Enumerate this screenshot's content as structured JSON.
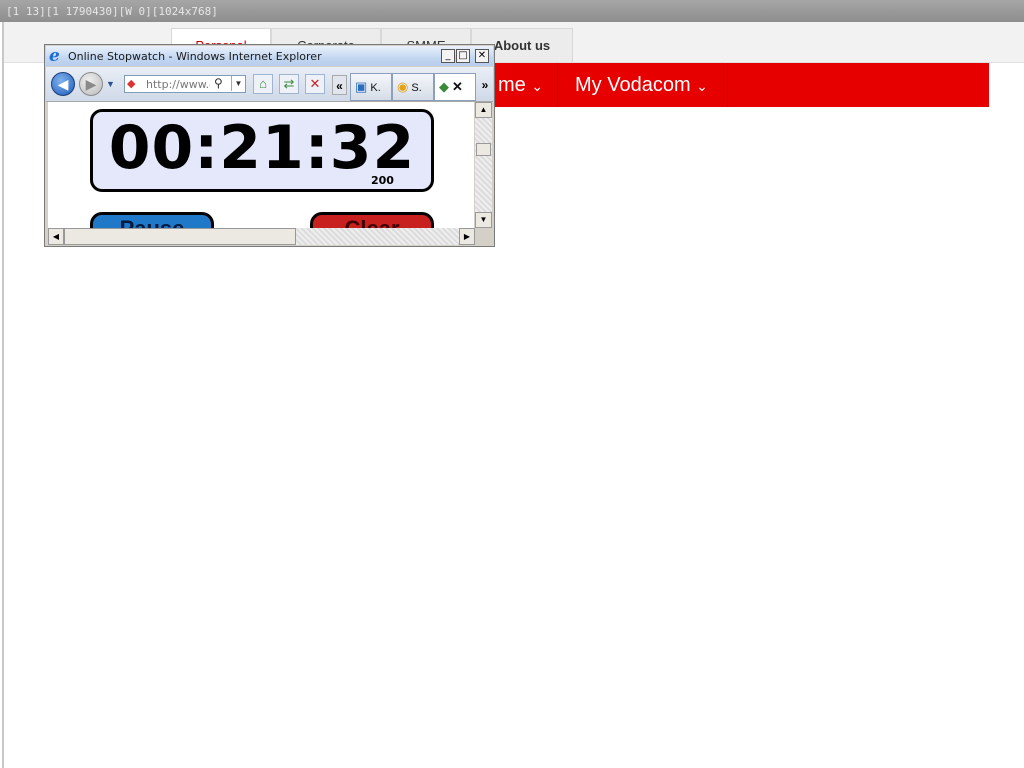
{
  "debug": {
    "text": "[1 13][1 1790430][W 0][1024x768]"
  },
  "vodacom": {
    "tabs": [
      "Personal",
      "Corporate",
      "SMME",
      "About us"
    ],
    "nav": {
      "home": "me",
      "my_vodacom": "My Vodacom",
      "chevron": "⌄"
    },
    "colors": {
      "brand_red": "#e60000"
    }
  },
  "ie": {
    "title": "Online Stopwatch - Windows Internet Explorer",
    "window_buttons": {
      "minimize": "_",
      "maximize": "□",
      "close": "✕"
    },
    "address": "http://www.o",
    "tabs": [
      {
        "label": "K."
      },
      {
        "label": "S."
      },
      {
        "label": "",
        "close": "✕"
      }
    ],
    "chevron_left": "«",
    "chevron_right": "»",
    "icons": [
      "ie-logo-icon",
      "back-arrow-icon",
      "forward-arrow-icon",
      "search-icon",
      "compat-view-icon",
      "refresh-icon",
      "stop-icon"
    ]
  },
  "stopwatch": {
    "time": "00:21:32",
    "milliseconds": "200",
    "pause_label": "Pause",
    "clear_label": "Clear",
    "colors": {
      "display_bg": "#e5e8fb",
      "pause": "#1f78c8",
      "clear": "#c81f1f"
    }
  }
}
